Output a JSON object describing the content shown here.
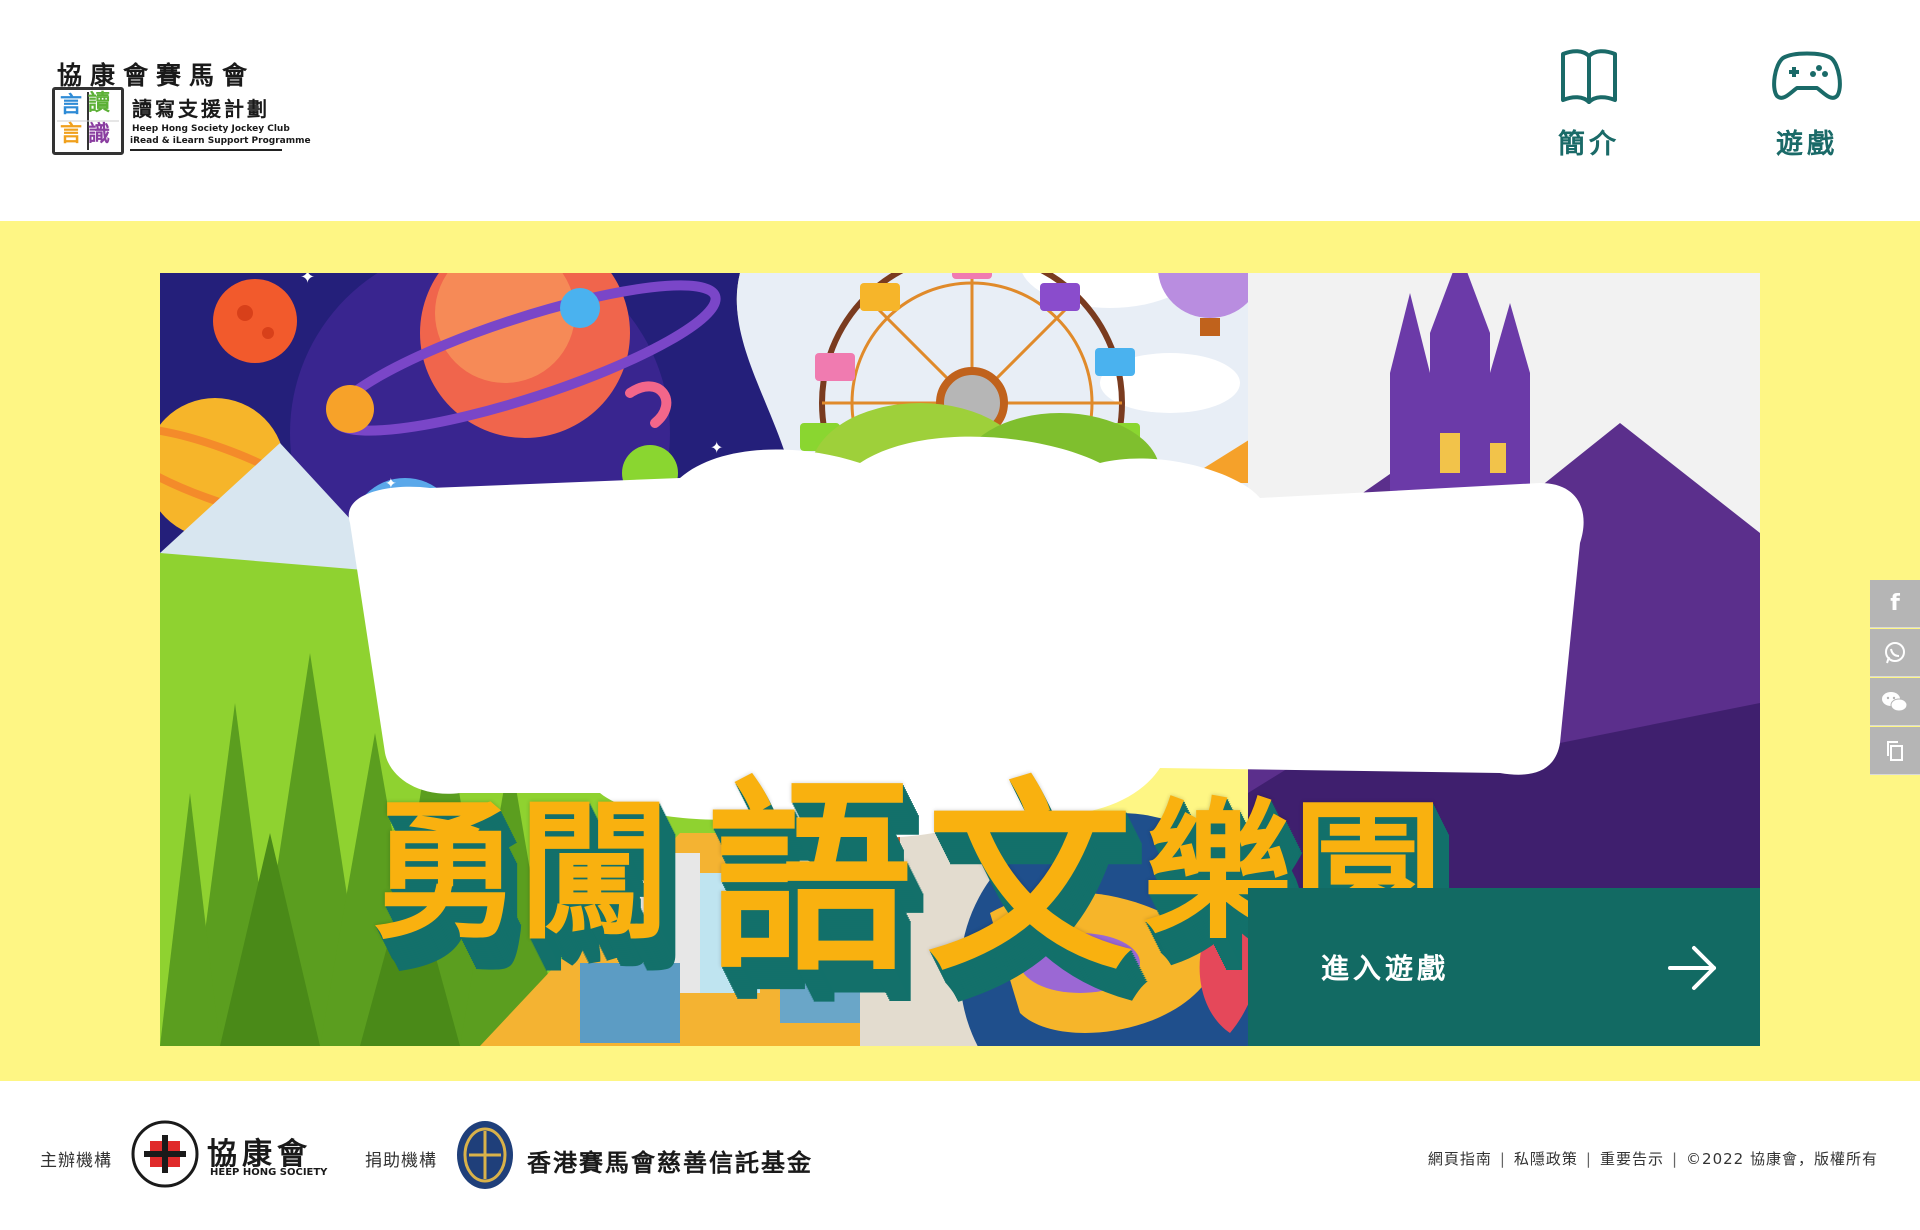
{
  "header": {
    "logo": {
      "org_cn": "協康會賽馬會",
      "book_chars": [
        "言賣",
        "言賣",
        "言",
        "言戠"
      ],
      "programme_cn": "讀寫支援計劃",
      "programme_en_line1": "Heep Hong Society Jockey Club",
      "programme_en_line2": "iRead & iLearn Support Programme"
    },
    "nav": [
      {
        "label": "簡介",
        "icon": "book-icon"
      },
      {
        "label": "遊戲",
        "icon": "gamepad-icon"
      }
    ]
  },
  "hero": {
    "title_chars": [
      "勇",
      "闖",
      "語",
      "文",
      "樂",
      "園"
    ],
    "enter_label": "進入遊戲",
    "enter_icon": "arrow-right-icon",
    "colors": {
      "background": "#fef684",
      "title_fill": "#f9b10f",
      "title_extrude": "#13706a",
      "enter_bg": "#126a63"
    }
  },
  "share": [
    {
      "icon": "facebook-icon",
      "glyph": "f"
    },
    {
      "icon": "whatsapp-icon",
      "glyph": ""
    },
    {
      "icon": "wechat-icon",
      "glyph": ""
    },
    {
      "icon": "copy-icon",
      "glyph": ""
    }
  ],
  "footer": {
    "organiser_label": "主辦機構",
    "organiser_name": "協康會",
    "organiser_name_en": "HEEP HONG SOCIETY",
    "funder_label": "捐助機構",
    "funder_name": "香港賽馬會慈善信託基金",
    "links": [
      "網頁指南",
      "私隱政策",
      "重要告示",
      "©2022 協康會，版權所有"
    ]
  }
}
